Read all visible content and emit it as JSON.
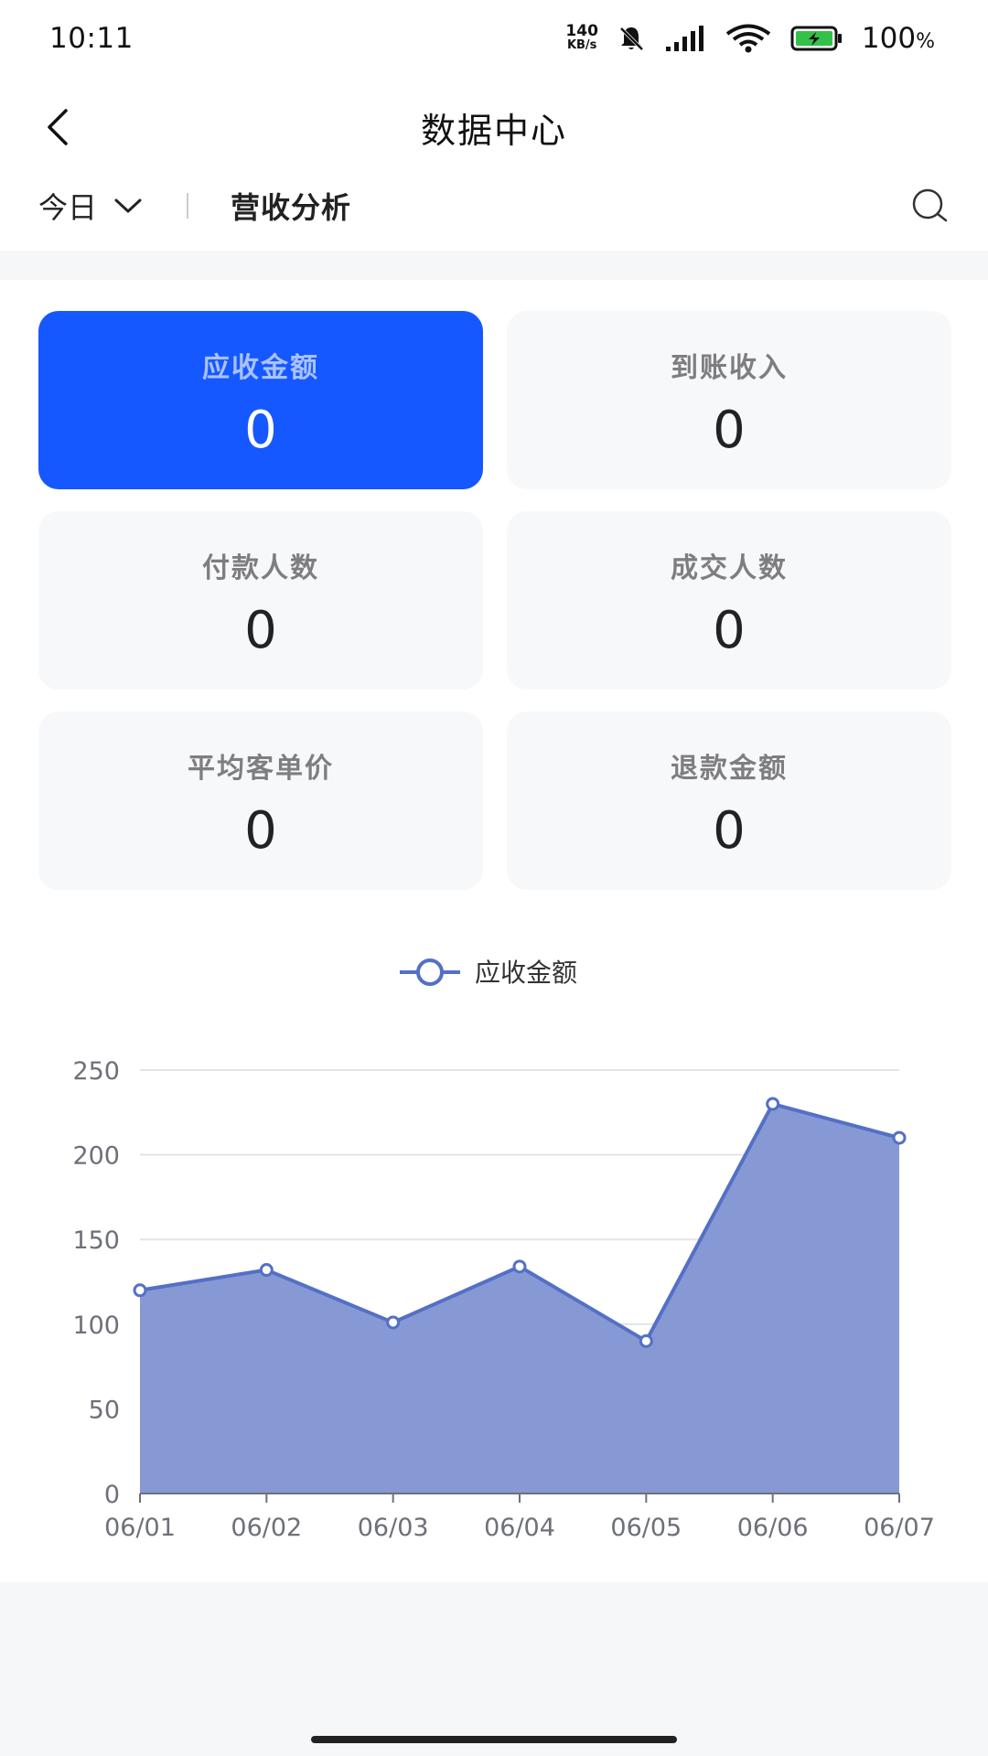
{
  "status_bar": {
    "time": "10:11",
    "net_speed_value": "140",
    "net_speed_unit": "KB/s",
    "battery_percent": "100",
    "battery_suffix": "%",
    "icons": [
      "bell-off-icon",
      "signal-icon",
      "wifi-icon",
      "battery-charging-icon"
    ]
  },
  "header": {
    "title": "数据中心",
    "back_icon": "chevron-left-icon"
  },
  "filter": {
    "period_label": "今日",
    "period_icon": "chevron-down-icon",
    "active_tab": "营收分析",
    "search_icon": "search-icon"
  },
  "stats": [
    {
      "label": "应收金额",
      "value": "0",
      "active": true
    },
    {
      "label": "到账收入",
      "value": "0",
      "active": false
    },
    {
      "label": "付款人数",
      "value": "0",
      "active": false
    },
    {
      "label": "成交人数",
      "value": "0",
      "active": false
    },
    {
      "label": "平均客单价",
      "value": "0",
      "active": false
    },
    {
      "label": "退款金额",
      "value": "0",
      "active": false
    }
  ],
  "colors": {
    "accent": "#1658ff",
    "series_line": "#5470c6",
    "series_fill": "#8799d4",
    "card_bg": "#f7f8fa"
  },
  "chart_data": {
    "type": "area",
    "categories": [
      "06/01",
      "06/02",
      "06/03",
      "06/04",
      "06/05",
      "06/06",
      "06/07"
    ],
    "series": [
      {
        "name": "应收金额",
        "values": [
          120,
          132,
          101,
          134,
          90,
          230,
          210
        ]
      }
    ],
    "ylim": [
      0,
      250
    ],
    "yticks": [
      0,
      50,
      100,
      150,
      200,
      250
    ],
    "grid": true,
    "legend": "top-center"
  }
}
